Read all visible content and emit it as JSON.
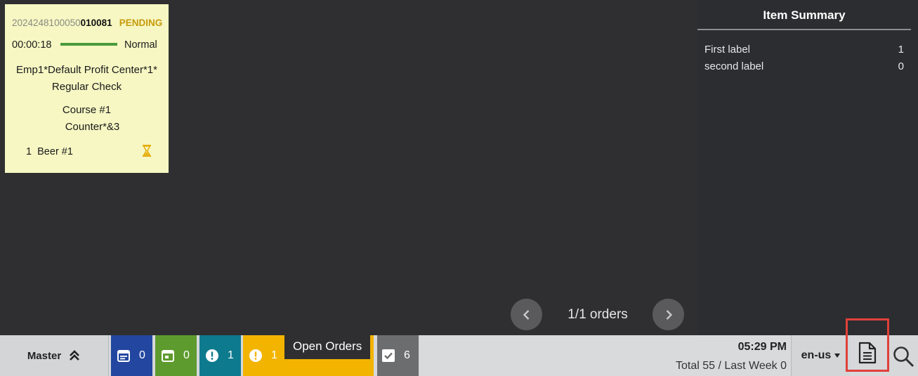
{
  "order_card": {
    "id_prefix": "202424810005",
    "id_mid": "0",
    "id_suffix": "010081",
    "status": "PENDING",
    "elapsed": "00:00:18",
    "priority": "Normal",
    "employee_line": "Emp1*Default Profit Center*1*",
    "check_type": "Regular Check",
    "course": "Course #1",
    "station": "Counter*&3",
    "item_qty": "1",
    "item_name": "Beer #1",
    "colors": {
      "card_bg": "#f6f7c3",
      "status": "#c79a0a",
      "timer_bar": "#4a9b3c"
    },
    "icon": "hourglass-icon"
  },
  "item_summary": {
    "title": "Item Summary",
    "rows": [
      {
        "label": "First label",
        "count": "1"
      },
      {
        "label": "second label",
        "count": "0"
      }
    ]
  },
  "pager": {
    "label": "1/1 orders",
    "prev_icon": "chevron-left-icon",
    "next_icon": "chevron-right-icon"
  },
  "footer": {
    "master_label": "Master",
    "master_icon": "double-chevron-up-icon",
    "tiles": [
      {
        "icon": "calendar-list-icon",
        "count": "0",
        "color": "#2347a0"
      },
      {
        "icon": "calendar-icon",
        "count": "0",
        "color": "#5e9b2e"
      },
      {
        "icon": "alert-circle-icon",
        "count": "1",
        "color": "#0e7a8e"
      },
      {
        "icon": "alert-circle-icon",
        "count": "1",
        "color": "#f3b400"
      },
      {
        "icon": "checkbox-icon",
        "count": "6",
        "color": "#6c6d6f"
      }
    ],
    "open_orders_tooltip": "Open Orders",
    "clock": "05:29 PM",
    "totals": "Total 55 / Last Week 0",
    "language": "en-us",
    "report_icon": "document-icon",
    "search_icon": "search-icon",
    "highlight_color": "#e0403a"
  }
}
